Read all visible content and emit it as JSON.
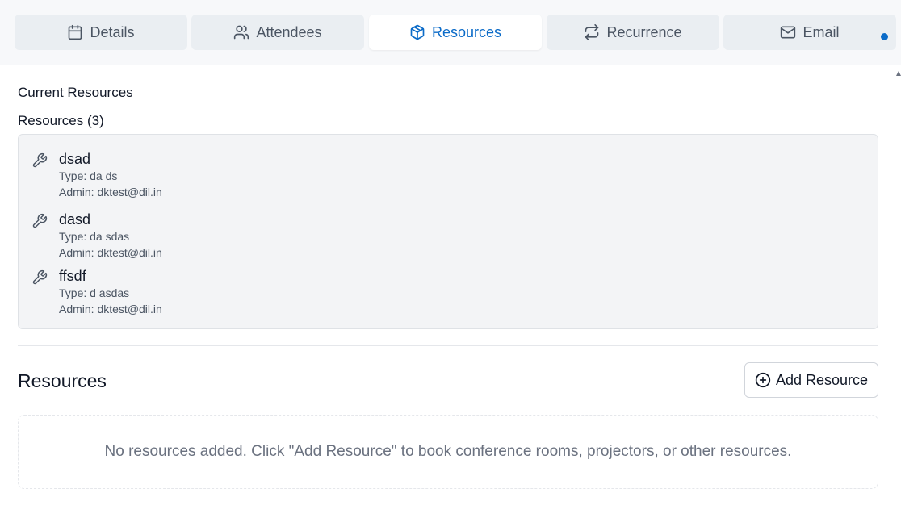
{
  "tabs": [
    {
      "label": "Details",
      "icon": "calendar-icon"
    },
    {
      "label": "Attendees",
      "icon": "users-icon"
    },
    {
      "label": "Resources",
      "icon": "box-icon"
    },
    {
      "label": "Recurrence",
      "icon": "repeat-icon"
    },
    {
      "label": "Email",
      "icon": "mail-icon"
    }
  ],
  "active_tab": "Resources",
  "accent_color": "#0b6bc8",
  "current": {
    "title": "Current Resources",
    "count_label": "Resources (3)",
    "items": [
      {
        "name": "dsad",
        "type": "Type: da ds",
        "admin": "Admin: dktest@dil.in"
      },
      {
        "name": "dasd",
        "type": "Type: da sdas",
        "admin": "Admin: dktest@dil.in"
      },
      {
        "name": "ffsdf",
        "type": "Type: d asdas",
        "admin": "Admin: dktest@dil.in"
      }
    ]
  },
  "resources": {
    "heading": "Resources",
    "add_button": "Add Resource",
    "empty_text": "No resources added. Click \"Add Resource\" to book conference rooms, projectors, or other resources."
  }
}
